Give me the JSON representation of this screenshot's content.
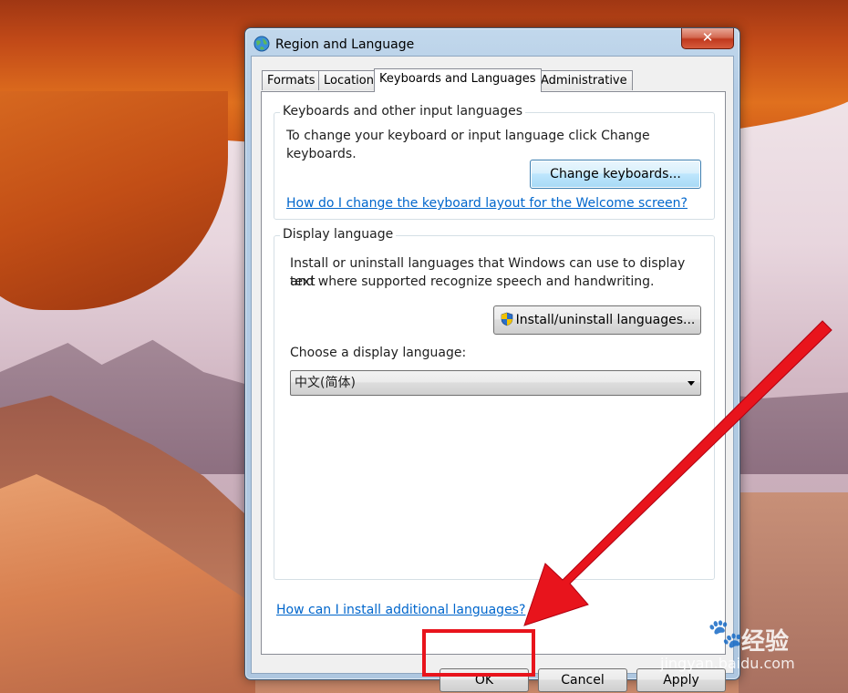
{
  "window": {
    "title": "Region and Language",
    "close_glyph": "✕"
  },
  "tabs": [
    {
      "label": "Formats",
      "active": false
    },
    {
      "label": "Location",
      "active": false
    },
    {
      "label": "Keyboards and Languages",
      "active": true
    },
    {
      "label": "Administrative",
      "active": false
    }
  ],
  "keyboards_group": {
    "title": "Keyboards and other input languages",
    "description": "To change your keyboard or input language click Change keyboards.",
    "change_button": "Change keyboards...",
    "welcome_link": "How do I change the keyboard layout for the Welcome screen?"
  },
  "display_group": {
    "title": "Display language",
    "description_line1": "Install or uninstall languages that Windows can use to display text",
    "description_line2": "and where supported recognize speech and handwriting.",
    "install_button": "Install/uninstall languages...",
    "choose_label": "Choose a display language:",
    "selected_language": "中文(简体)"
  },
  "footer": {
    "install_link": "How can I install additional languages?",
    "ok": "OK",
    "cancel": "Cancel",
    "apply": "Apply"
  },
  "watermark": {
    "brand": "Bai🐾",
    "sub": "经验",
    "url": "jingyan.baidu.com"
  },
  "colors": {
    "annotation_red": "#e8141c",
    "link": "#0066cc",
    "focus_blue": "#3c7fb1"
  },
  "icons": [
    "globe-icon",
    "close-icon",
    "uac-shield-icon",
    "dropdown-arrow-icon"
  ]
}
